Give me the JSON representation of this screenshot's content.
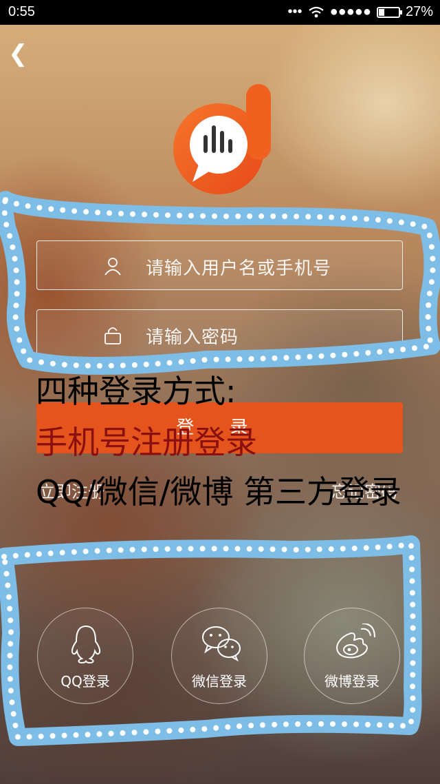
{
  "status": {
    "time": "0:55",
    "signal": "••• ",
    "battery_pct": "27%",
    "battery_level": 0.27
  },
  "nav": {
    "back_glyph": "❮"
  },
  "form": {
    "username_placeholder": "请输入用户名或手机号",
    "password_placeholder": "请输入密码",
    "login_label": "登 录",
    "register_link": "立即注册",
    "forgot_link": "忘记密码"
  },
  "annotation": {
    "line1": "四种登录方式:",
    "line2": "手机号注册登录",
    "line3": "QQ/微信/微博 第三方登录"
  },
  "social": [
    {
      "label": "QQ登录",
      "icon": "qq-icon"
    },
    {
      "label": "微信登录",
      "icon": "wechat-icon"
    },
    {
      "label": "微博登录",
      "icon": "weibo-icon"
    }
  ],
  "colors": {
    "brand_orange": "#e5541c",
    "doodle_blue": "#7dbde6"
  }
}
